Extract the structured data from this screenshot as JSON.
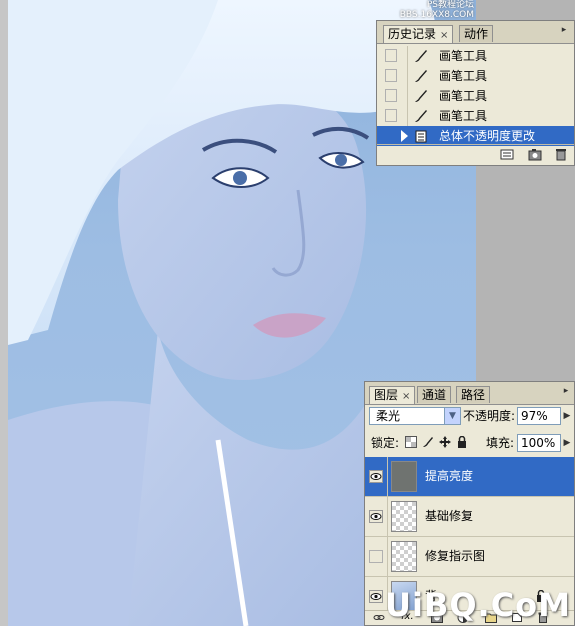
{
  "canvas": {
    "watermark_top_line1": "PS教程论坛",
    "watermark_top_line2": "BBS.16XX8.COM",
    "watermark_bottom": "UiBQ.CoM"
  },
  "history_panel": {
    "tabs": [
      {
        "label": "历史记录",
        "active": true,
        "close": "×"
      },
      {
        "label": "动作",
        "active": false
      }
    ],
    "menu_glyph": "▸",
    "items": [
      {
        "label": "画笔工具",
        "icon": "brush-icon"
      },
      {
        "label": "画笔工具",
        "icon": "brush-icon"
      },
      {
        "label": "画笔工具",
        "icon": "brush-icon"
      },
      {
        "label": "画笔工具",
        "icon": "brush-icon"
      },
      {
        "label": "总体不透明度更改",
        "icon": "layer-properties-icon",
        "selected": true
      }
    ],
    "footer_icons": [
      "new-document-from-state-icon",
      "snapshot-camera-icon",
      "trash-icon"
    ]
  },
  "layers_panel": {
    "tabs": [
      {
        "label": "图层",
        "active": true,
        "close": "×"
      },
      {
        "label": "通道",
        "active": false
      },
      {
        "label": "路径",
        "active": false
      }
    ],
    "menu_glyph": "▸",
    "blend_mode": "柔光",
    "opacity_label": "不透明度:",
    "opacity_value": "97%",
    "lock_label": "锁定:",
    "fill_label": "填充:",
    "fill_value": "100%",
    "lock_icons": [
      "lock-transparency-icon",
      "lock-pixels-icon",
      "lock-position-icon",
      "lock-all-icon"
    ],
    "layers": [
      {
        "name": "提高亮度",
        "visible": true,
        "selected": true,
        "thumb": "dark"
      },
      {
        "name": "基础修复",
        "visible": true,
        "selected": false,
        "thumb": "transparent"
      },
      {
        "name": "修复指示图",
        "visible": false,
        "selected": false,
        "thumb": "transparent"
      },
      {
        "name": "背",
        "visible": true,
        "selected": false,
        "thumb": "photo",
        "locked": true
      }
    ],
    "footer_icons": [
      "link-icon",
      "fx-icon",
      "mask-icon",
      "adjustment-icon",
      "group-folder-icon",
      "new-layer-icon",
      "trash-icon"
    ],
    "fx_label": "fx."
  },
  "colors": {
    "selection": "#316ac5",
    "panel_bg": "#ece9d8",
    "canvas_bg": "#9dbde3"
  }
}
